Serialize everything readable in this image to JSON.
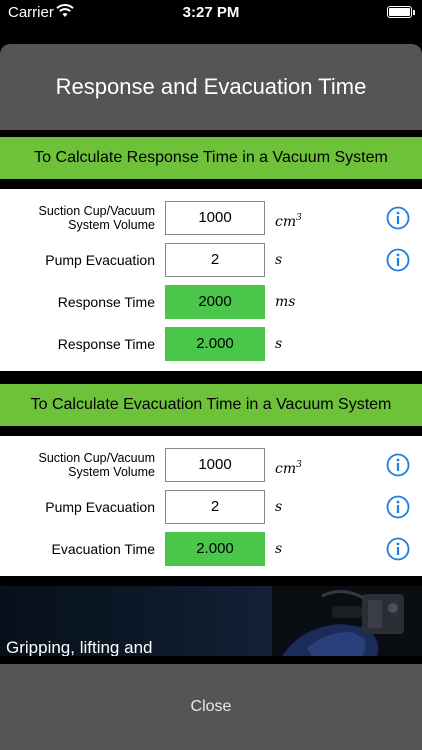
{
  "status_bar": {
    "carrier": "Carrier",
    "time": "3:27 PM"
  },
  "header": {
    "title": "Response and Evacuation Time"
  },
  "response_section": {
    "title": "To Calculate Response Time in a Vacuum System",
    "rows": [
      {
        "label": "Suction Cup/Vacuum System Volume",
        "value": "1000",
        "unit": "cm",
        "unit_sup": "3",
        "result": false
      },
      {
        "label": "Pump Evacuation",
        "value": "2",
        "unit": "s",
        "unit_sup": "",
        "result": false
      },
      {
        "label": "Response Time",
        "value": "2000",
        "unit": "ms",
        "unit_sup": "",
        "result": true
      },
      {
        "label": "Response Time",
        "value": "2.000",
        "unit": "s",
        "unit_sup": "",
        "result": true
      }
    ]
  },
  "evacuation_section": {
    "title": "To Calculate Evacuation Time in a Vacuum System",
    "rows": [
      {
        "label": "Suction Cup/Vacuum System Volume",
        "value": "1000",
        "unit": "cm",
        "unit_sup": "3",
        "result": false
      },
      {
        "label": "Pump Evacuation",
        "value": "2",
        "unit": "s",
        "unit_sup": "",
        "result": false
      },
      {
        "label": "Evacuation Time",
        "value": "2.000",
        "unit": "s",
        "unit_sup": "",
        "result": true
      }
    ]
  },
  "banner": {
    "tagline": "Gripping, lifting and"
  },
  "footer": {
    "close_label": "Close"
  },
  "colors": {
    "accent_green": "#6ec23a",
    "result_green": "#4ac64a",
    "info_blue": "#1a7fe0",
    "header_gray": "#555555"
  },
  "icons": {
    "info": "info-circle-icon",
    "wifi": "wifi-icon",
    "battery": "battery-icon"
  }
}
